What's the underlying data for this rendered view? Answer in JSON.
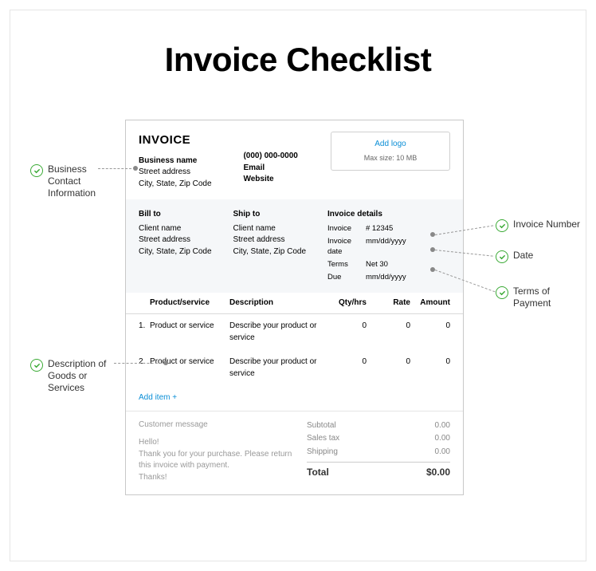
{
  "title": "Invoice Checklist",
  "invoice": {
    "heading": "INVOICE",
    "business": {
      "name": "Business name",
      "street": "Street address",
      "citystate": "City, State, Zip Code",
      "phone": "(000) 000-0000",
      "email": "Email",
      "website": "Website"
    },
    "logo": {
      "link": "Add logo",
      "sub": "Max size: 10 MB"
    },
    "billto": {
      "label": "Bill to",
      "name": "Client name",
      "street": "Street address",
      "citystate": "City, State, Zip Code"
    },
    "shipto": {
      "label": "Ship to",
      "name": "Client name",
      "street": "Street address",
      "citystate": "City, State, Zip Code"
    },
    "details": {
      "label": "Invoice details",
      "invoice_lbl": "Invoice",
      "invoice_val": "# 12345",
      "date_lbl": "Invoice date",
      "date_val": "mm/dd/yyyy",
      "terms_lbl": "Terms",
      "terms_val": "Net 30",
      "due_lbl": "Due",
      "due_val": "mm/dd/yyyy"
    },
    "table": {
      "headers": {
        "prod": "Product/service",
        "desc": "Description",
        "qty": "Qty/hrs",
        "rate": "Rate",
        "amt": "Amount"
      },
      "rows": [
        {
          "num": "1.",
          "prod": "Product or service",
          "desc": "Describe your product or service",
          "qty": "0",
          "rate": "0",
          "amt": "0"
        },
        {
          "num": "2.",
          "prod": "Product or service",
          "desc": "Describe your product or service",
          "qty": "0",
          "rate": "0",
          "amt": "0"
        }
      ],
      "add": "Add item +"
    },
    "message": {
      "title": "Customer message",
      "greeting": "Hello!",
      "body": "Thank you for your purchase. Please return this invoice with payment.",
      "closing": "Thanks!"
    },
    "totals": {
      "subtotal_lbl": "Subtotal",
      "subtotal": "0.00",
      "tax_lbl": "Sales tax",
      "tax": "0.00",
      "shipping_lbl": "Shipping",
      "shipping": "0.00",
      "total_lbl": "Total",
      "total": "$0.00"
    }
  },
  "annotations": {
    "business": "Business Contact Information",
    "description": "Description of Goods or Services",
    "invoice_num": "Invoice Number",
    "date": "Date",
    "terms": "Terms of Payment"
  }
}
